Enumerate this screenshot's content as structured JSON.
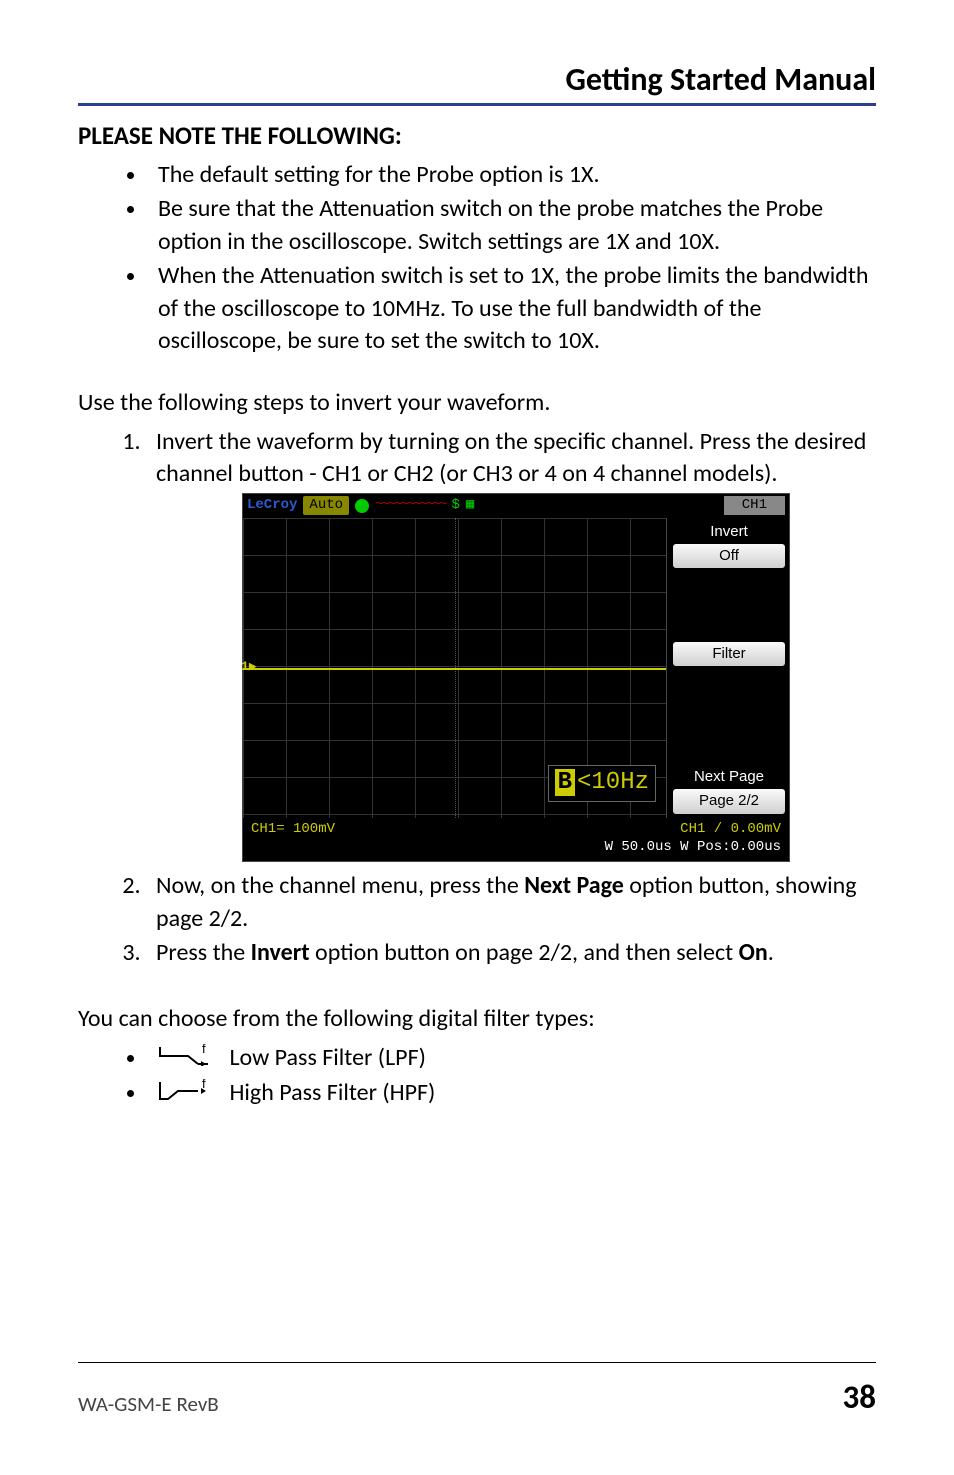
{
  "header": {
    "title": "Getting Started Manual"
  },
  "note": {
    "heading": "PLEASE NOTE THE FOLLOWING",
    "colon": ":",
    "items": [
      " The default setting for the Probe option is 1X.",
      "Be sure that the Attenuation switch on the probe matches the Probe option in the oscilloscope. Switch settings are 1X and 10X.",
      "When the Attenuation switch is set to 1X, the probe limits the bandwidth of the oscilloscope to 10MHz. To use the full bandwidth of the oscilloscope, be sure to set the switch to 10X."
    ]
  },
  "invert": {
    "intro": "Use the following steps to invert your waveform.",
    "step1": "Invert the waveform by turning on the specific channel. Press the desired channel button - CH1 or CH2 (or CH3 or 4 on 4 channel models).",
    "step2_pre": "Now, on the channel menu, press the ",
    "step2_bold": "Next Page",
    "step2_post": " option button, showing page 2/2.",
    "step3_pre": "Press the ",
    "step3_bold1": "Invert",
    "step3_mid": " option button on page 2/2, and then select ",
    "step3_bold2": "On",
    "step3_post": "."
  },
  "scope": {
    "brand": "LeCroy",
    "mode": "Auto",
    "ch_header": "CH1",
    "menu": {
      "invert_label": "Invert",
      "invert_value": "Off",
      "filter_label": "Filter",
      "nextpage_label": "Next Page",
      "page_value": "Page 2/2"
    },
    "marker": "1",
    "bw_b": "B",
    "bw_text": "<10Hz",
    "bottom_left": "CH1= 100mV",
    "bottom_right_top": "CH1 / 0.00mV",
    "bottom_right_bot": "W 50.0us W Pos:0.00us"
  },
  "filters": {
    "intro": "You can choose from the following digital filter types:",
    "lpf": "  Low Pass Filter (LPF)",
    "hpf": "  High Pass Filter (HPF)"
  },
  "footer": {
    "left": "WA-GSM-E RevB",
    "page": "38"
  }
}
